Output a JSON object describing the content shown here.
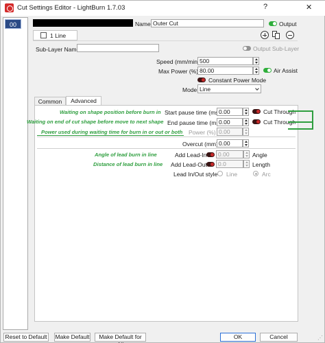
{
  "window": {
    "title": "Cut Settings Editor - LightBurn 1.7.03",
    "help_label": "?",
    "close_label": "✕"
  },
  "layer_list": {
    "selected": "00"
  },
  "header": {
    "name_label": "Name",
    "name_value": "Outer Cut",
    "output_label": "Output",
    "sublayer_tab": "1 Line"
  },
  "sublayer": {
    "name_label": "Sub-Layer Name",
    "name_value": "",
    "output_label": "Output Sub-Layer"
  },
  "params": {
    "speed_label": "Speed (mm/min)",
    "speed_value": "500",
    "power_label": "Max Power (%)",
    "power_value": "80.00",
    "air_label": "Air Assist",
    "cpm_label": "Constant Power Mode",
    "mode_label": "Mode",
    "mode_value": "Line"
  },
  "tabs": {
    "common": "Common",
    "advanced": "Advanced"
  },
  "advanced": {
    "start_pause_label": "Start pause time (ms)",
    "start_pause_value": "0.00",
    "start_cut_through": "Cut Through",
    "end_pause_label": "End pause time (ms)",
    "end_pause_value": "0.00",
    "end_cut_through": "Cut Through",
    "power_label": "Power (%)",
    "power_value": "0.00",
    "overcut_label": "Overcut (mm)",
    "overcut_value": "0.00",
    "lead_in_label": "Add Lead-In",
    "lead_in_value": "0.00",
    "lead_in_unit": "Angle",
    "lead_out_label": "Add Lead-Out",
    "lead_out_value": "0.0",
    "lead_out_unit": "Length",
    "style_label": "Lead In/Out style",
    "style_line": "Line",
    "style_arc": "Arc"
  },
  "annotations": {
    "a1": "Waiting on shape position before burn in",
    "a2": "Waiting on end of cut shape before move to next shape",
    "a3": "Power used during waiting time for burn in or out or both",
    "a4": "Angle of lead burn in line",
    "a5": "Distance of lead burn in line"
  },
  "footer": {
    "reset": "Reset to Default",
    "make_default": "Make Default",
    "make_default_all": "Make Default for All",
    "ok": "OK",
    "cancel": "Cancel"
  },
  "colors": {
    "annotation": "#2e9e3e",
    "toggle_on": "#2fae3b",
    "toggle_red": "#c92a2a",
    "layer_selected": "#2b4a85"
  }
}
